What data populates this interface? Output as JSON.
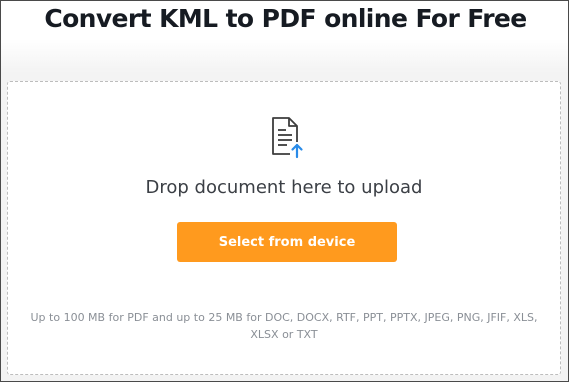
{
  "header": {
    "title": "Convert KML to PDF online For Free"
  },
  "upload": {
    "icon": "document-upload-icon",
    "drop_text": "Drop document here to upload",
    "select_button_label": "Select from device",
    "limits_text": "Up to 100 MB for PDF and up to 25 MB for DOC, DOCX, RTF, PPT, PPTX, JPEG, PNG, JFIF, XLS, XLSX or TXT"
  },
  "colors": {
    "accent": "#ff9a1e",
    "upload_arrow": "#2a8be8",
    "title_text": "#161b22",
    "muted_text": "#8a8f96"
  }
}
